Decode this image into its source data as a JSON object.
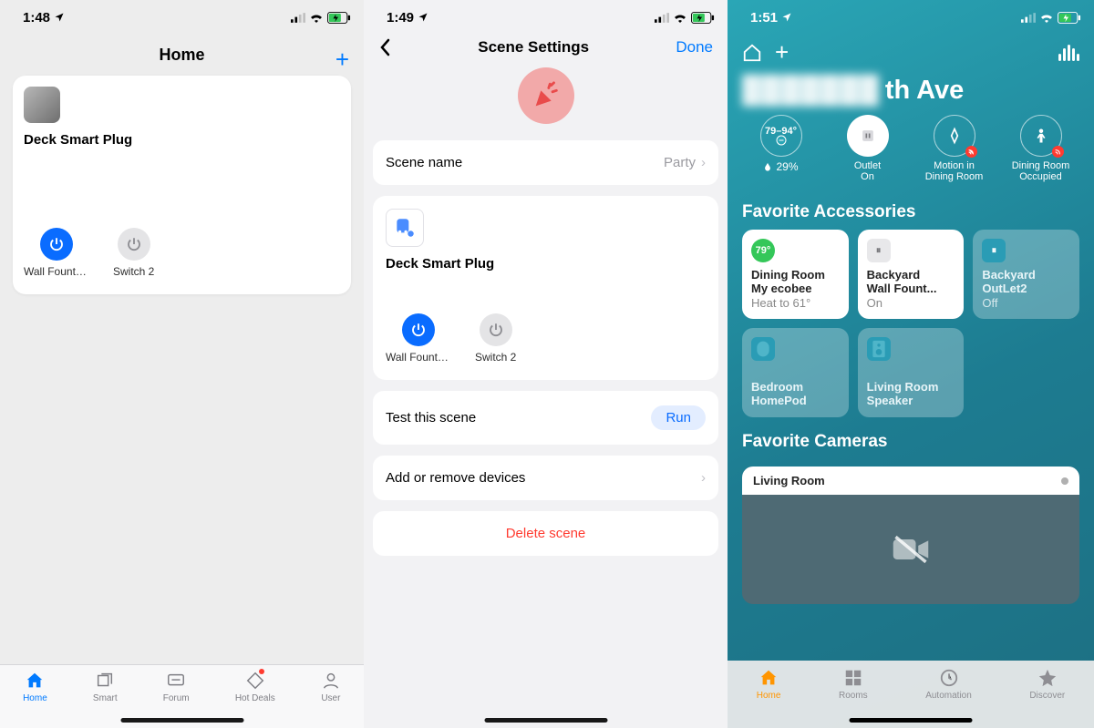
{
  "phone1": {
    "time": "1:48",
    "title": "Home",
    "device_name": "Deck Smart Plug",
    "switches": [
      {
        "label": "Wall Fountai...",
        "on": true
      },
      {
        "label": "Switch 2",
        "on": false
      }
    ],
    "tabs": [
      "Home",
      "Smart",
      "Forum",
      "Hot Deals",
      "User"
    ]
  },
  "phone2": {
    "time": "1:49",
    "title": "Scene Settings",
    "done": "Done",
    "scene_name_label": "Scene name",
    "scene_name_value": "Party",
    "device_name": "Deck Smart Plug",
    "switches": [
      {
        "label": "Wall Fountai...",
        "on": true
      },
      {
        "label": "Switch 2",
        "on": false
      }
    ],
    "test_label": "Test this scene",
    "run_label": "Run",
    "addremove_label": "Add or remove devices",
    "delete_label": "Delete scene"
  },
  "phone3": {
    "time": "1:51",
    "home_name_redacted": "████ █th Ave",
    "home_name_visible": "th Ave",
    "temp_range": "79–94°",
    "humidity": "29%",
    "summary": [
      {
        "label_top": "Outlet",
        "label_bot": "On"
      },
      {
        "label_top": "Motion in",
        "label_bot": "Dining Room"
      },
      {
        "label_top": "Dining Room",
        "label_bot": "Occupied"
      }
    ],
    "fav_access_title": "Favorite Accessories",
    "tiles": [
      {
        "style": "light",
        "icon_text": "79°",
        "icon_bg": "#34c759",
        "l1": "Dining Room",
        "l2": "My ecobee",
        "l3": "Heat to 61°"
      },
      {
        "style": "light",
        "icon_text": "⏸",
        "icon_bg": "#e8e8ea",
        "l1": "Backyard",
        "l2": "Wall Fount...",
        "l3": "On"
      },
      {
        "style": "dim",
        "icon_text": "⏸",
        "icon_bg": "#2a9cb5",
        "l1": "Backyard",
        "l2": "OutLet2",
        "l3": "Off"
      },
      {
        "style": "dim",
        "icon_text": "",
        "icon_bg": "#2a9cb5",
        "l1": "Bedroom",
        "l2": "HomePod",
        "l3": ""
      },
      {
        "style": "dim",
        "icon_text": "",
        "icon_bg": "#2a9cb5",
        "l1": "Living Room",
        "l2": "Speaker",
        "l3": ""
      }
    ],
    "fav_cam_title": "Favorite Cameras",
    "camera_name": "Living Room",
    "tabs": [
      "Home",
      "Rooms",
      "Automation",
      "Discover"
    ]
  }
}
